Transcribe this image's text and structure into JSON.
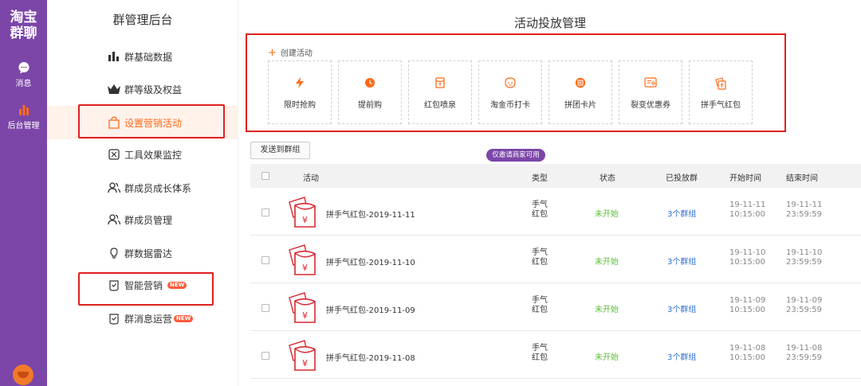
{
  "rail": {
    "brand_line1": "淘宝",
    "brand_line2": "群聊",
    "msg_label": "消息",
    "admin_label": "后台管理"
  },
  "sidebar": {
    "title": "群管理后台",
    "items": [
      {
        "label": "群基础数据",
        "icon": "bar-chart-icon"
      },
      {
        "label": "群等级及权益",
        "icon": "crown-icon"
      },
      {
        "label": "设置营销活动",
        "icon": "bag-icon",
        "active": true
      },
      {
        "label": "工具效果监控",
        "icon": "monitor-icon"
      },
      {
        "label": "群成员成长体系",
        "icon": "people-icon"
      },
      {
        "label": "群成员管理",
        "icon": "people-icon"
      },
      {
        "label": "群数据雷达",
        "icon": "bulb-icon"
      },
      {
        "label": "智能营销",
        "icon": "shield-icon",
        "badge": "NEW"
      },
      {
        "label": "群消息运营",
        "icon": "shield-icon",
        "badge": "NEW"
      }
    ]
  },
  "main": {
    "title": "活动投放管理",
    "create_label": "创建活动",
    "cards": [
      {
        "label": "限时抢购",
        "icon": "lightning-icon"
      },
      {
        "label": "提前购",
        "icon": "clock-icon"
      },
      {
        "label": "红包喷泉",
        "icon": "red-envelope-icon"
      },
      {
        "label": "淘金币打卡",
        "icon": "coin-face-icon"
      },
      {
        "label": "拼团卡片",
        "icon": "group-tag-icon"
      },
      {
        "label": "裂变优惠券",
        "icon": "coupon-icon"
      },
      {
        "label": "拼手气红包",
        "icon": "lucky-envelope-icon"
      }
    ],
    "pill": "仅邀请商家可用",
    "send_button": "发送到群组",
    "table": {
      "headers": {
        "activity": "活动",
        "type": "类型",
        "status": "状态",
        "groups": "已投放群",
        "start": "开始时间",
        "end": "结束时间"
      },
      "rows": [
        {
          "name": "拼手气红包-2019-11-11",
          "type1": "手气",
          "type2": "红包",
          "status": "未开始",
          "groups": "3个群组",
          "start_date": "19-11-11",
          "start_time": "10:15:00",
          "end_date": "19-11-11",
          "end_time": "23:59:59"
        },
        {
          "name": "拼手气红包-2019-11-10",
          "type1": "手气",
          "type2": "红包",
          "status": "未开始",
          "groups": "3个群组",
          "start_date": "19-11-10",
          "start_time": "10:15:00",
          "end_date": "19-11-10",
          "end_time": "23:59:59"
        },
        {
          "name": "拼手气红包-2019-11-09",
          "type1": "手气",
          "type2": "红包",
          "status": "未开始",
          "groups": "3个群组",
          "start_date": "19-11-09",
          "start_time": "10:15:00",
          "end_date": "19-11-09",
          "end_time": "23:59:59"
        },
        {
          "name": "拼手气红包-2019-11-08",
          "type1": "手气",
          "type2": "红包",
          "status": "未开始",
          "groups": "3个群组",
          "start_date": "19-11-08",
          "start_time": "10:15:00",
          "end_date": "19-11-08",
          "end_time": "23:59:59"
        }
      ]
    }
  },
  "colors": {
    "brand": "#7b46a8",
    "accent": "#ff6a1a",
    "highlight_box": "#e02020",
    "status_pending": "#5bbf3a",
    "link": "#2f6fd0"
  }
}
